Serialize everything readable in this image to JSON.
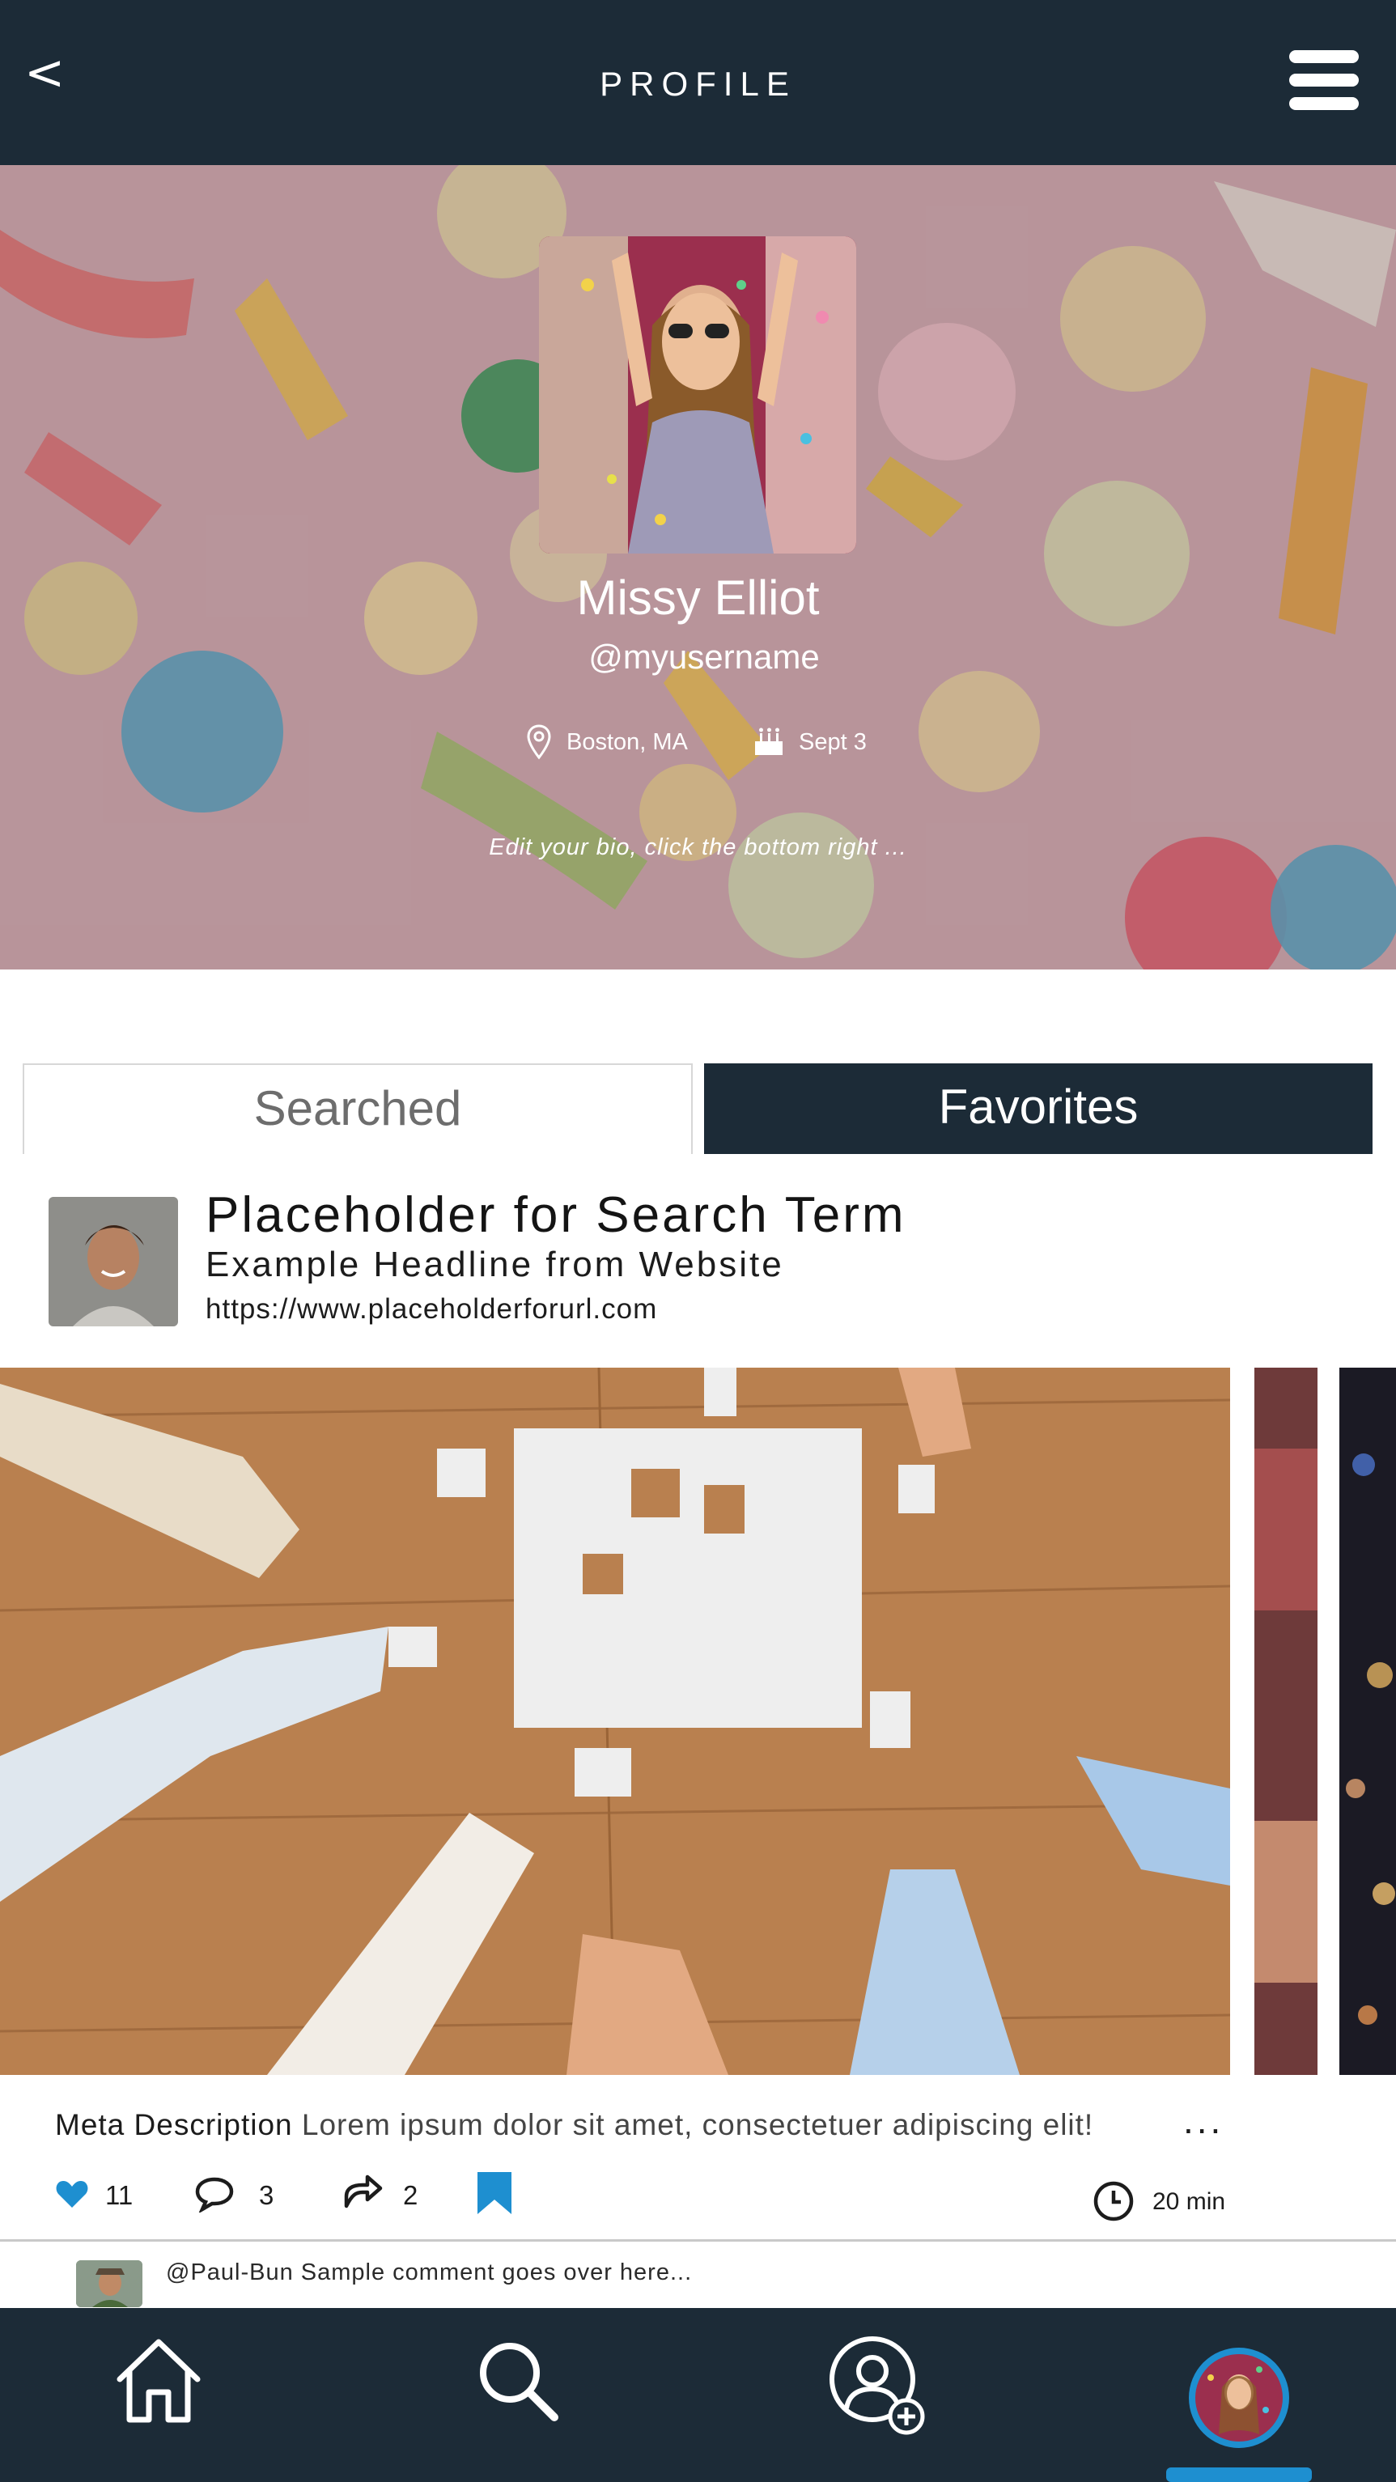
{
  "header": {
    "title": "PROFILE",
    "back_glyph": "<",
    "back_icon": "back-chevron-icon",
    "menu_icon": "hamburger-menu-icon"
  },
  "profile": {
    "name": "Missy Elliot",
    "username": "@myusername",
    "location": "Boston, MA",
    "birthday": "Sept 3",
    "bio": "Edit your bio, click the bottom right ..."
  },
  "tabs": [
    {
      "label": "Searched",
      "active": false
    },
    {
      "label": "Favorites",
      "active": true
    }
  ],
  "post": {
    "title": "Placeholder for Search Term",
    "headline": "Example Headline from Website",
    "url": "https://www.placeholderforurl.com",
    "meta_label": "Meta Description",
    "meta_text": " Lorem ipsum dolor sit amet, consectetuer adipiscing elit!",
    "more": "...",
    "likes": "11",
    "comments": "3",
    "shares": "2",
    "read_time": "20 min",
    "bookmarked": true
  },
  "comment": {
    "text": "@Paul-Bun Sample comment goes over here..."
  },
  "nav": {
    "items": [
      "home-icon",
      "search-icon",
      "add-user-icon",
      "profile-avatar"
    ],
    "active": "profile-avatar"
  },
  "colors": {
    "navy": "#1c2b37",
    "accent_blue": "#1e8fd0",
    "white": "#ffffff"
  }
}
